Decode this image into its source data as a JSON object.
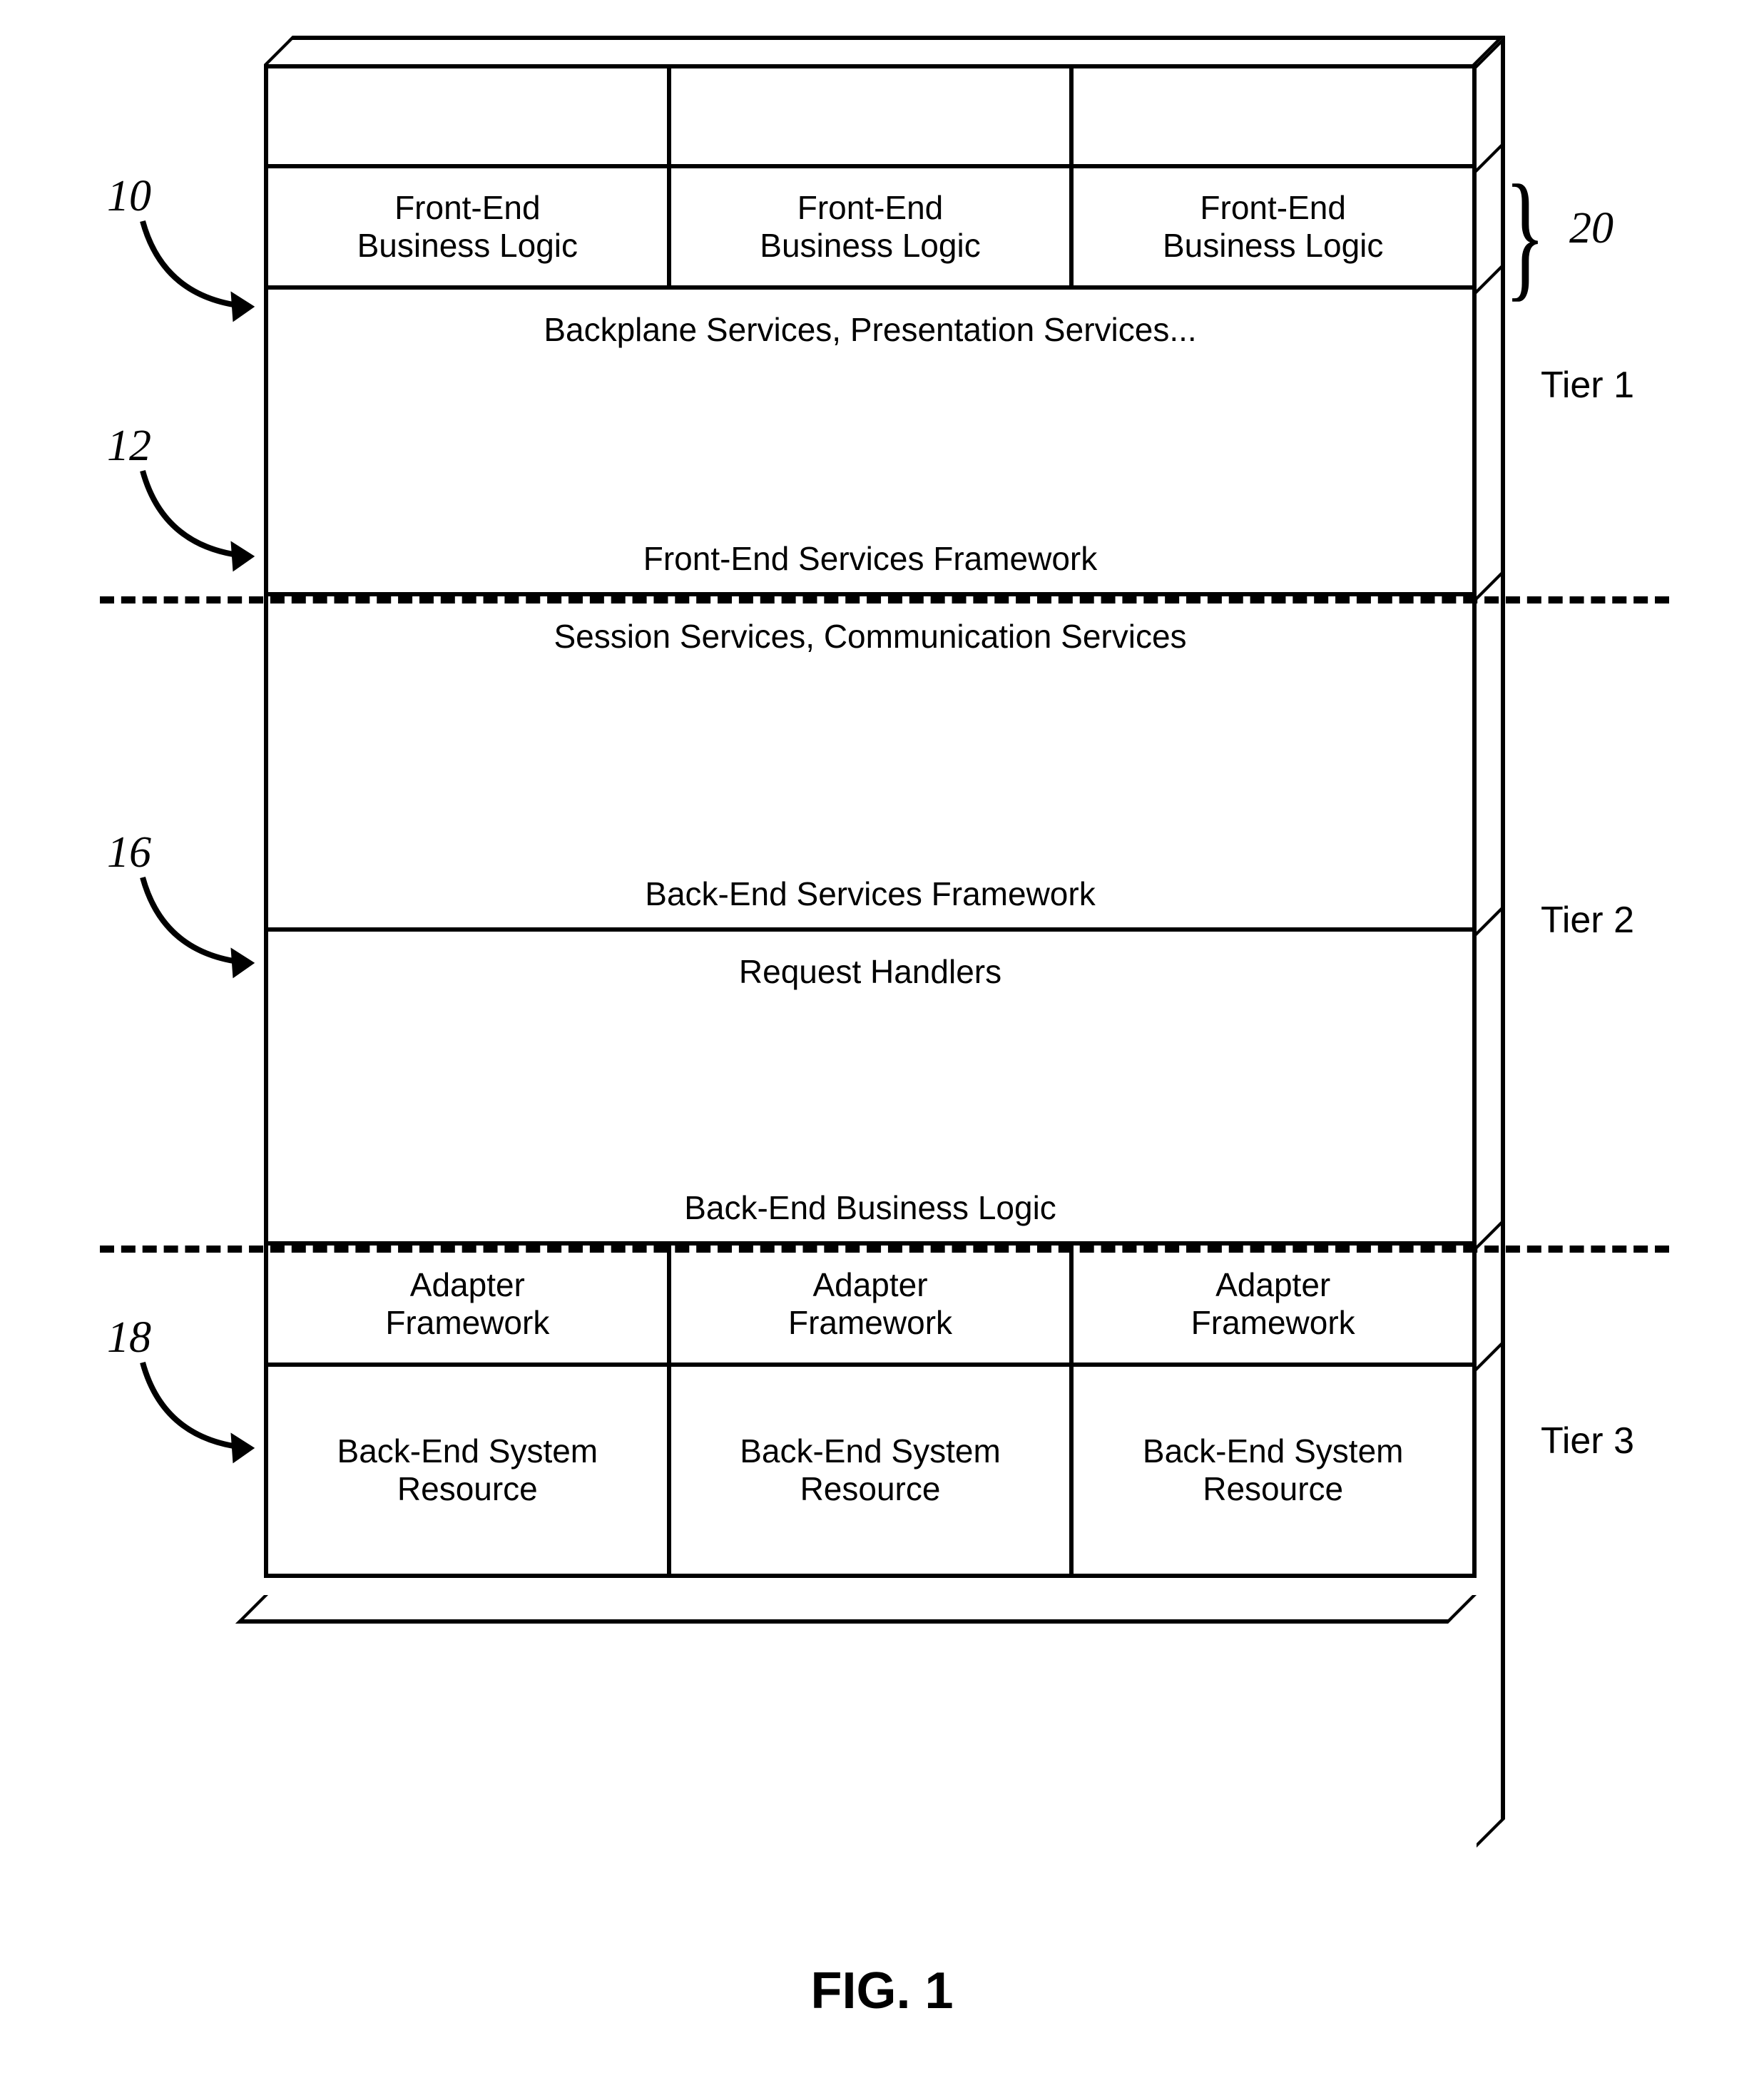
{
  "figure_label": "FIG. 1",
  "refs": {
    "r10": "10",
    "r12": "12",
    "r16": "16",
    "r18": "18",
    "r20": "20"
  },
  "tiers": {
    "t1": "Tier 1",
    "t2": "Tier 2",
    "t3": "Tier 3"
  },
  "blocks": {
    "fe_logic": "Front-End\nBusiness Logic",
    "backplane": "Backplane Services, Presentation Services...",
    "fe_framework": "Front-End Services Framework",
    "session": "Session Services, Communication Services",
    "be_framework": "Back-End Services Framework",
    "req_handlers": "Request Handlers",
    "be_logic": "Back-End Business Logic",
    "adapter": "Adapter\nFramework",
    "be_resource": "Back-End System\nResource"
  }
}
